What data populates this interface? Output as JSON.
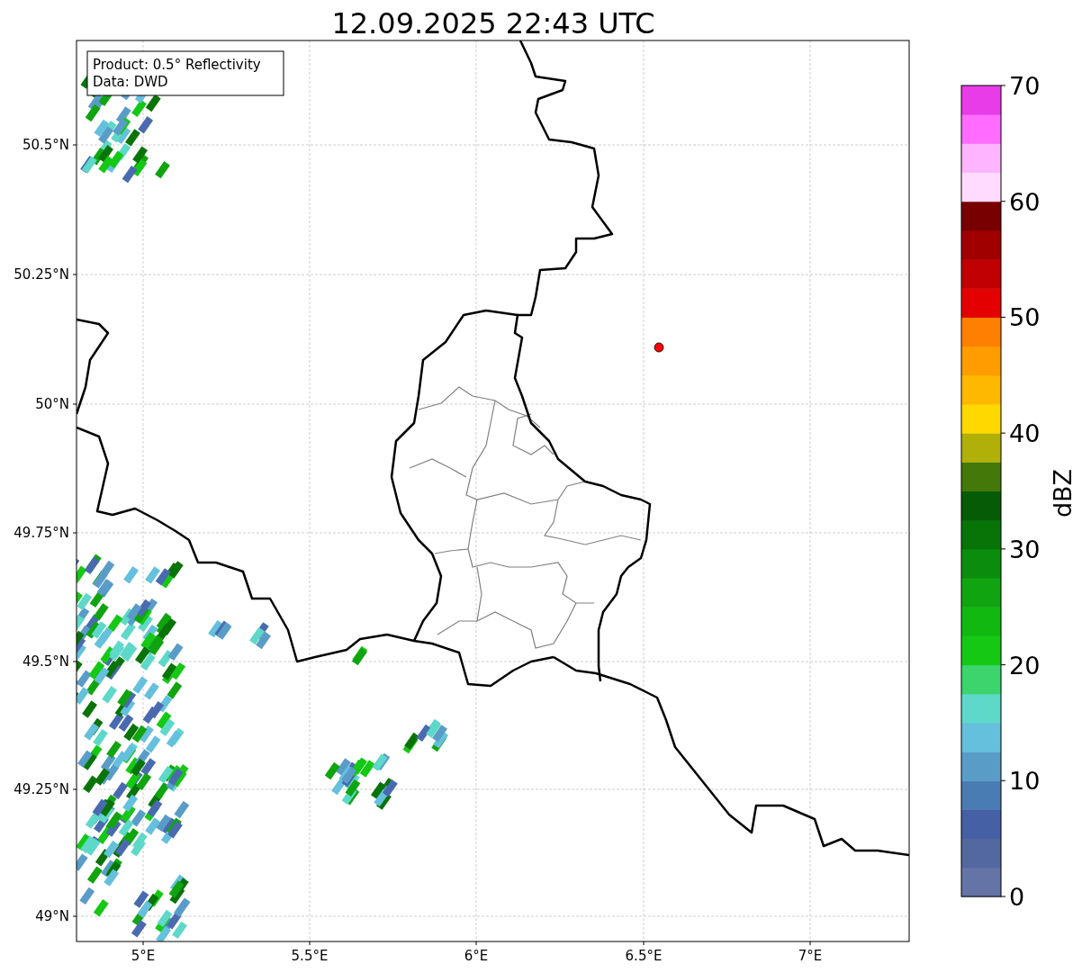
{
  "title": "12.09.2025 22:43 UTC",
  "info_box": [
    "Product: 0.5° Reflectivity",
    "Data: DWD"
  ],
  "x_ticks": [
    "5°E",
    "5.5°E",
    "6°E",
    "6.5°E",
    "7°E"
  ],
  "y_ticks": [
    "50.5°N",
    "50.25°N",
    "50°N",
    "49.75°N",
    "49.5°N",
    "49.25°N",
    "49°N"
  ],
  "colorbar": {
    "label": "dBZ",
    "ticks": [
      "70",
      "60",
      "50",
      "40",
      "30",
      "20",
      "10",
      "0"
    ],
    "segments": [
      {
        "color": "#6474a6"
      },
      {
        "color": "#5468a0"
      },
      {
        "color": "#4560a4"
      },
      {
        "color": "#4a7cb4"
      },
      {
        "color": "#5a9cc8"
      },
      {
        "color": "#64c0dc"
      },
      {
        "color": "#5ed8c8"
      },
      {
        "color": "#3cd46c"
      },
      {
        "color": "#14c814"
      },
      {
        "color": "#10b810"
      },
      {
        "color": "#10a410"
      },
      {
        "color": "#0c8c0c"
      },
      {
        "color": "#087408"
      },
      {
        "color": "#065c06"
      },
      {
        "color": "#447808"
      },
      {
        "color": "#b0b008"
      },
      {
        "color": "#ffd800"
      },
      {
        "color": "#ffb800"
      },
      {
        "color": "#ff9c00"
      },
      {
        "color": "#ff8000"
      },
      {
        "color": "#e40000"
      },
      {
        "color": "#c00000"
      },
      {
        "color": "#a00000"
      },
      {
        "color": "#780000"
      },
      {
        "color": "#ffdcff"
      },
      {
        "color": "#ffb4ff"
      },
      {
        "color": "#ff6cff"
      },
      {
        "color": "#e83ce8"
      }
    ]
  }
}
